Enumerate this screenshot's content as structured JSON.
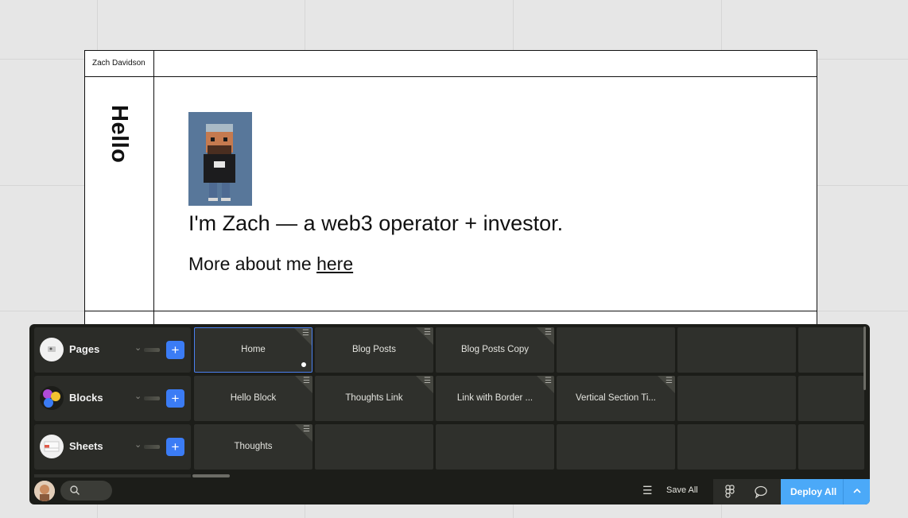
{
  "site": {
    "name": "Zach Davidson",
    "hello": "Hello",
    "headline": "I'm Zach — a web3 operator + investor.",
    "more_prefix": "More about me ",
    "more_link": "here"
  },
  "panel": {
    "rows": [
      {
        "label": "Pages",
        "icon": "pages-icon"
      },
      {
        "label": "Blocks",
        "icon": "blocks-icon"
      },
      {
        "label": "Sheets",
        "icon": "sheets-icon"
      }
    ],
    "add_label": "+",
    "cells": {
      "pages": [
        "Home",
        "Blog Posts",
        "Blog Posts Copy"
      ],
      "blocks": [
        "Hello Block",
        "Thoughts Link",
        "Link with Border ...",
        "Vertical Section Ti..."
      ],
      "sheets": [
        "Thoughts"
      ]
    }
  },
  "footer": {
    "save_all": "Save All",
    "deploy_all": "Deploy All"
  },
  "colors": {
    "accent_blue": "#3b7cf5",
    "deploy_blue": "#4ba9f8",
    "panel_bg": "#1c1d19"
  }
}
